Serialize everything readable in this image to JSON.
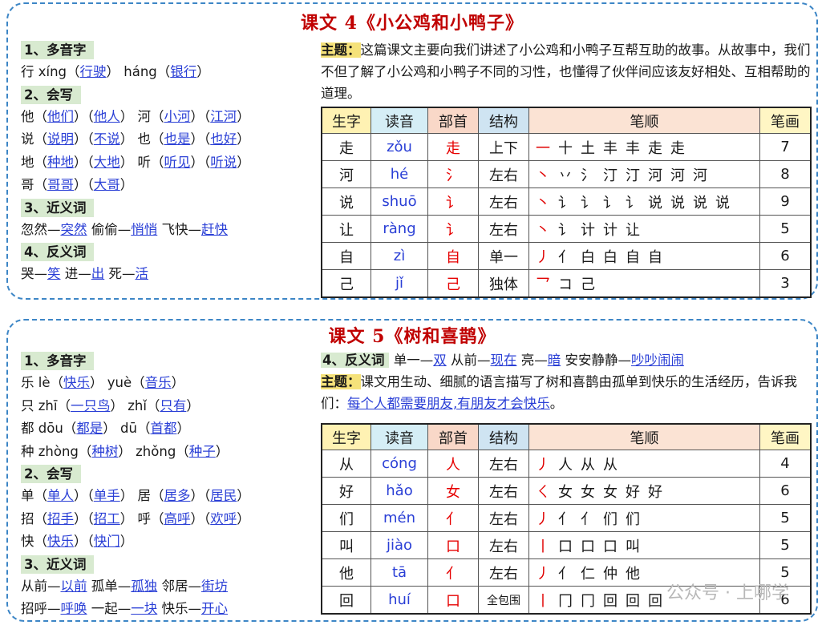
{
  "lesson4": {
    "title": "课文 4《小公鸡和小鸭子》",
    "polyphone_heading": "1、多音字",
    "polyphone": [
      {
        "char": "行",
        "p1": "xíng",
        "w1": "行驶",
        "p2": "háng",
        "w2": "银行"
      }
    ],
    "write_heading": "2、会写",
    "write_lines": [
      {
        "c1": "他",
        "w1": "他们",
        "w2": "他人",
        "c2": "河",
        "w3": "小河",
        "w4": "江河"
      },
      {
        "c1": "说",
        "w1": "说明",
        "w2": "不说",
        "c2": "也",
        "w3": "也是",
        "w4": "也好"
      },
      {
        "c1": "地",
        "w1": "种地",
        "w2": "大地",
        "c2": "听",
        "w3": "听见",
        "w4": "听说"
      },
      {
        "c1": "哥",
        "w1": "哥哥",
        "w2": "大哥",
        "c2": "",
        "w3": "",
        "w4": ""
      }
    ],
    "syn_heading": "3、近义词",
    "synonyms": [
      {
        "a": "忽然",
        "b": "突然"
      },
      {
        "a": "偷偷",
        "b": "悄悄"
      },
      {
        "a": "飞快",
        "b": "赶快"
      }
    ],
    "ant_heading": "4、反义词",
    "antonyms": [
      {
        "a": "哭",
        "b": "笑"
      },
      {
        "a": "进",
        "b": "出"
      },
      {
        "a": "死",
        "b": "活"
      }
    ],
    "theme_label": "主题：",
    "theme_text": "这篇课文主要向我们讲述了小公鸡和小鸭子互帮互助的故事。从故事中，我们不但了解了小公鸡和小鸭子不同的习性，也懂得了伙伴间应该友好相处、互相帮助的道理。",
    "table_headers": [
      "生字",
      "读音",
      "部首",
      "结构",
      "笔顺",
      "笔画"
    ],
    "rows": [
      {
        "char": "走",
        "pinyin": "zǒu",
        "radical": "走",
        "structure": "上下",
        "strokes": [
          "一",
          "十",
          "土",
          "丰",
          "丰",
          "走",
          "走"
        ],
        "count": "7"
      },
      {
        "char": "河",
        "pinyin": "hé",
        "radical": "氵",
        "structure": "左右",
        "strokes": [
          "丶",
          "丷",
          "氵",
          "汀",
          "汀",
          "河",
          "河",
          "河"
        ],
        "count": "8"
      },
      {
        "char": "说",
        "pinyin": "shuō",
        "radical": "讠",
        "structure": "左右",
        "strokes": [
          "丶",
          "讠",
          "讠",
          "讠",
          "讠",
          "说",
          "说",
          "说",
          "说"
        ],
        "count": "9"
      },
      {
        "char": "让",
        "pinyin": "ràng",
        "radical": "讠",
        "structure": "左右",
        "strokes": [
          "丶",
          "讠",
          "计",
          "计",
          "让"
        ],
        "count": "5"
      },
      {
        "char": "自",
        "pinyin": "zì",
        "radical": "自",
        "structure": "单一",
        "strokes": [
          "丿",
          "亻",
          "白",
          "白",
          "自",
          "自"
        ],
        "count": "6"
      },
      {
        "char": "己",
        "pinyin": "jǐ",
        "radical": "己",
        "structure": "独体",
        "strokes": [
          "乛",
          "コ",
          "己"
        ],
        "count": "3"
      }
    ]
  },
  "lesson5": {
    "title": "课文 5《树和喜鹊》",
    "polyphone_heading": "1、多音字",
    "polyphone": [
      {
        "char": "乐",
        "p1": "lè",
        "w1": "快乐",
        "p2": "yuè",
        "w2": "音乐"
      },
      {
        "char": "只",
        "p1": "zhī",
        "w1": "一只鸟",
        "p2": "zhǐ",
        "w2": "只有"
      },
      {
        "char": "都",
        "p1": "dōu",
        "w1": "都是",
        "p2": "dū",
        "w2": "首都"
      },
      {
        "char": "种",
        "p1": "zhòng",
        "w1": "种树",
        "p2": "zhǒng",
        "w2": "种子"
      }
    ],
    "write_heading": "2、会写",
    "write_lines": [
      {
        "c1": "单",
        "w1": "单人",
        "w2": "单手",
        "c2": "居",
        "w3": "居多",
        "w4": "居民"
      },
      {
        "c1": "招",
        "w1": "招手",
        "w2": "招工",
        "c2": "呼",
        "w3": "高呼",
        "w4": "欢呼"
      },
      {
        "c1": "快",
        "w1": "快乐",
        "w2": "快门",
        "c2": "",
        "w3": "",
        "w4": ""
      }
    ],
    "syn_heading": "3、近义词",
    "synonyms_line1": [
      {
        "a": "从前",
        "b": "以前"
      },
      {
        "a": "孤单",
        "b": "孤独"
      },
      {
        "a": "邻居",
        "b": "街坊"
      }
    ],
    "synonyms_line2": [
      {
        "a": "招呼",
        "b": "呼唤"
      },
      {
        "a": "一起",
        "b": "一块"
      },
      {
        "a": "快乐",
        "b": "开心"
      }
    ],
    "ant_heading": "4、反义词",
    "antonyms": [
      {
        "a": "单一",
        "b": "双"
      },
      {
        "a": "从前",
        "b": "现在"
      },
      {
        "a": "亮",
        "b": "暗"
      },
      {
        "a": "安安静静",
        "b": "吵吵闹闹"
      }
    ],
    "theme_label": "主题：",
    "theme_text": "课文用生动、细腻的语言描写了树和喜鹊由孤单到快乐的生活经历，告诉我们：",
    "theme_underlined": "每个人都需要朋友,有朋友才会快乐",
    "theme_end": "。",
    "table_headers": [
      "生字",
      "读音",
      "部首",
      "结构",
      "笔顺",
      "笔画"
    ],
    "rows": [
      {
        "char": "从",
        "pinyin": "cóng",
        "radical": "人",
        "structure": "左右",
        "strokes": [
          "丿",
          "人",
          "从",
          "从"
        ],
        "count": "4"
      },
      {
        "char": "好",
        "pinyin": "hǎo",
        "radical": "女",
        "structure": "左右",
        "strokes": [
          "ㄑ",
          "女",
          "女",
          "女",
          "好",
          "好"
        ],
        "count": "6"
      },
      {
        "char": "们",
        "pinyin": "mén",
        "radical": "亻",
        "structure": "左右",
        "strokes": [
          "丿",
          "亻",
          "亻",
          "们",
          "们"
        ],
        "count": "5"
      },
      {
        "char": "叫",
        "pinyin": "jiào",
        "radical": "口",
        "structure": "左右",
        "strokes": [
          "丨",
          "口",
          "口",
          "口",
          "叫"
        ],
        "count": "5"
      },
      {
        "char": "他",
        "pinyin": "tā",
        "radical": "亻",
        "structure": "左右",
        "strokes": [
          "丿",
          "亻",
          "仁",
          "仲",
          "他"
        ],
        "count": "5"
      },
      {
        "char": "回",
        "pinyin": "huí",
        "radical": "口",
        "structure": "全包围",
        "strokes": [
          "丨",
          "冂",
          "冂",
          "回",
          "回",
          "回"
        ],
        "count": "6"
      }
    ]
  },
  "watermark": "公众号 · 上哪学"
}
